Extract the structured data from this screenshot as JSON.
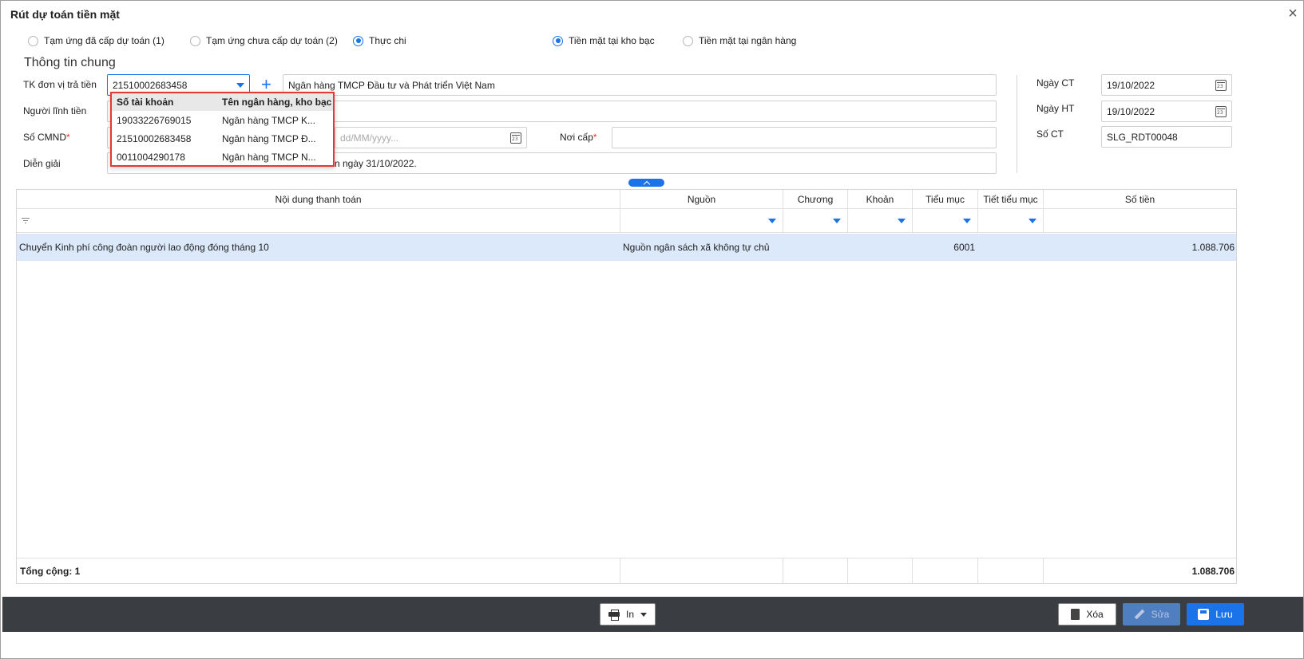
{
  "window": {
    "title": "Rút dự toán tiền mặt"
  },
  "radios_left": [
    {
      "label": "Tạm ứng đã cấp dự toán (1)",
      "selected": false
    },
    {
      "label": "Tạm ứng chưa cấp dự toán (2)",
      "selected": false
    },
    {
      "label": "Thực chi",
      "selected": true
    }
  ],
  "radios_right": [
    {
      "label": "Tiền mặt tại kho bạc",
      "selected": true
    },
    {
      "label": "Tiền mặt tại ngân hàng",
      "selected": false
    }
  ],
  "section": {
    "title": "Thông tin chung"
  },
  "form": {
    "account_label": "TK đơn vị trả tiền",
    "account_value": "21510002683458",
    "bank_name_value": "Ngân hàng TMCP Đầu tư và Phát triển Việt Nam",
    "receiver_label": "Người lĩnh tiền",
    "id_label": "Số CMND",
    "id_required": "*",
    "date_placeholder": "dd/MM/yyyy...",
    "issued_place_label": "Nơi cấp",
    "issued_place_required": "*",
    "description_label": "Diễn giải",
    "description_value": "n ngày 31/10/2022.",
    "ngay_ct_label": "Ngày CT",
    "ngay_ct_value": "19/10/2022",
    "ngay_ht_label": "Ngày HT",
    "ngay_ht_value": "19/10/2022",
    "so_ct_label": "Số CT",
    "so_ct_value": "SLG_RDT00048"
  },
  "dropdown": {
    "headers": [
      "Số tài khoản",
      "Tên ngân hàng, kho bạc"
    ],
    "rows": [
      [
        "19033226769015",
        "Ngân hàng TMCP K..."
      ],
      [
        "21510002683458",
        "Ngân hàng TMCP Đ..."
      ],
      [
        "0011004290178",
        "Ngân hàng TMCP N..."
      ]
    ]
  },
  "grid": {
    "headers": [
      "Nội dung thanh toán",
      "Nguồn",
      "Chương",
      "Khoản",
      "Tiểu mục",
      "Tiết tiểu mục",
      "Số tiền"
    ],
    "rows": [
      {
        "content": "Chuyển Kinh phí công đoàn người lao động đóng tháng 10",
        "source": "Nguồn ngân sách xã không tự chủ",
        "chapter": "",
        "item": "",
        "sub_item": "6001",
        "sub_sub_item": "",
        "amount": "1.088.706"
      }
    ],
    "footer_label": "Tổng cộng: 1",
    "footer_total": "1.088.706"
  },
  "toolbar": {
    "print_label": "In",
    "delete_label": "Xóa",
    "edit_label": "Sửa",
    "save_label": "Lưu"
  },
  "colors": {
    "accent": "#1a73e8",
    "highlight_row": "#dbe9fb",
    "footer_bar": "#3a3d42",
    "dropdown_border": "#e53935"
  }
}
